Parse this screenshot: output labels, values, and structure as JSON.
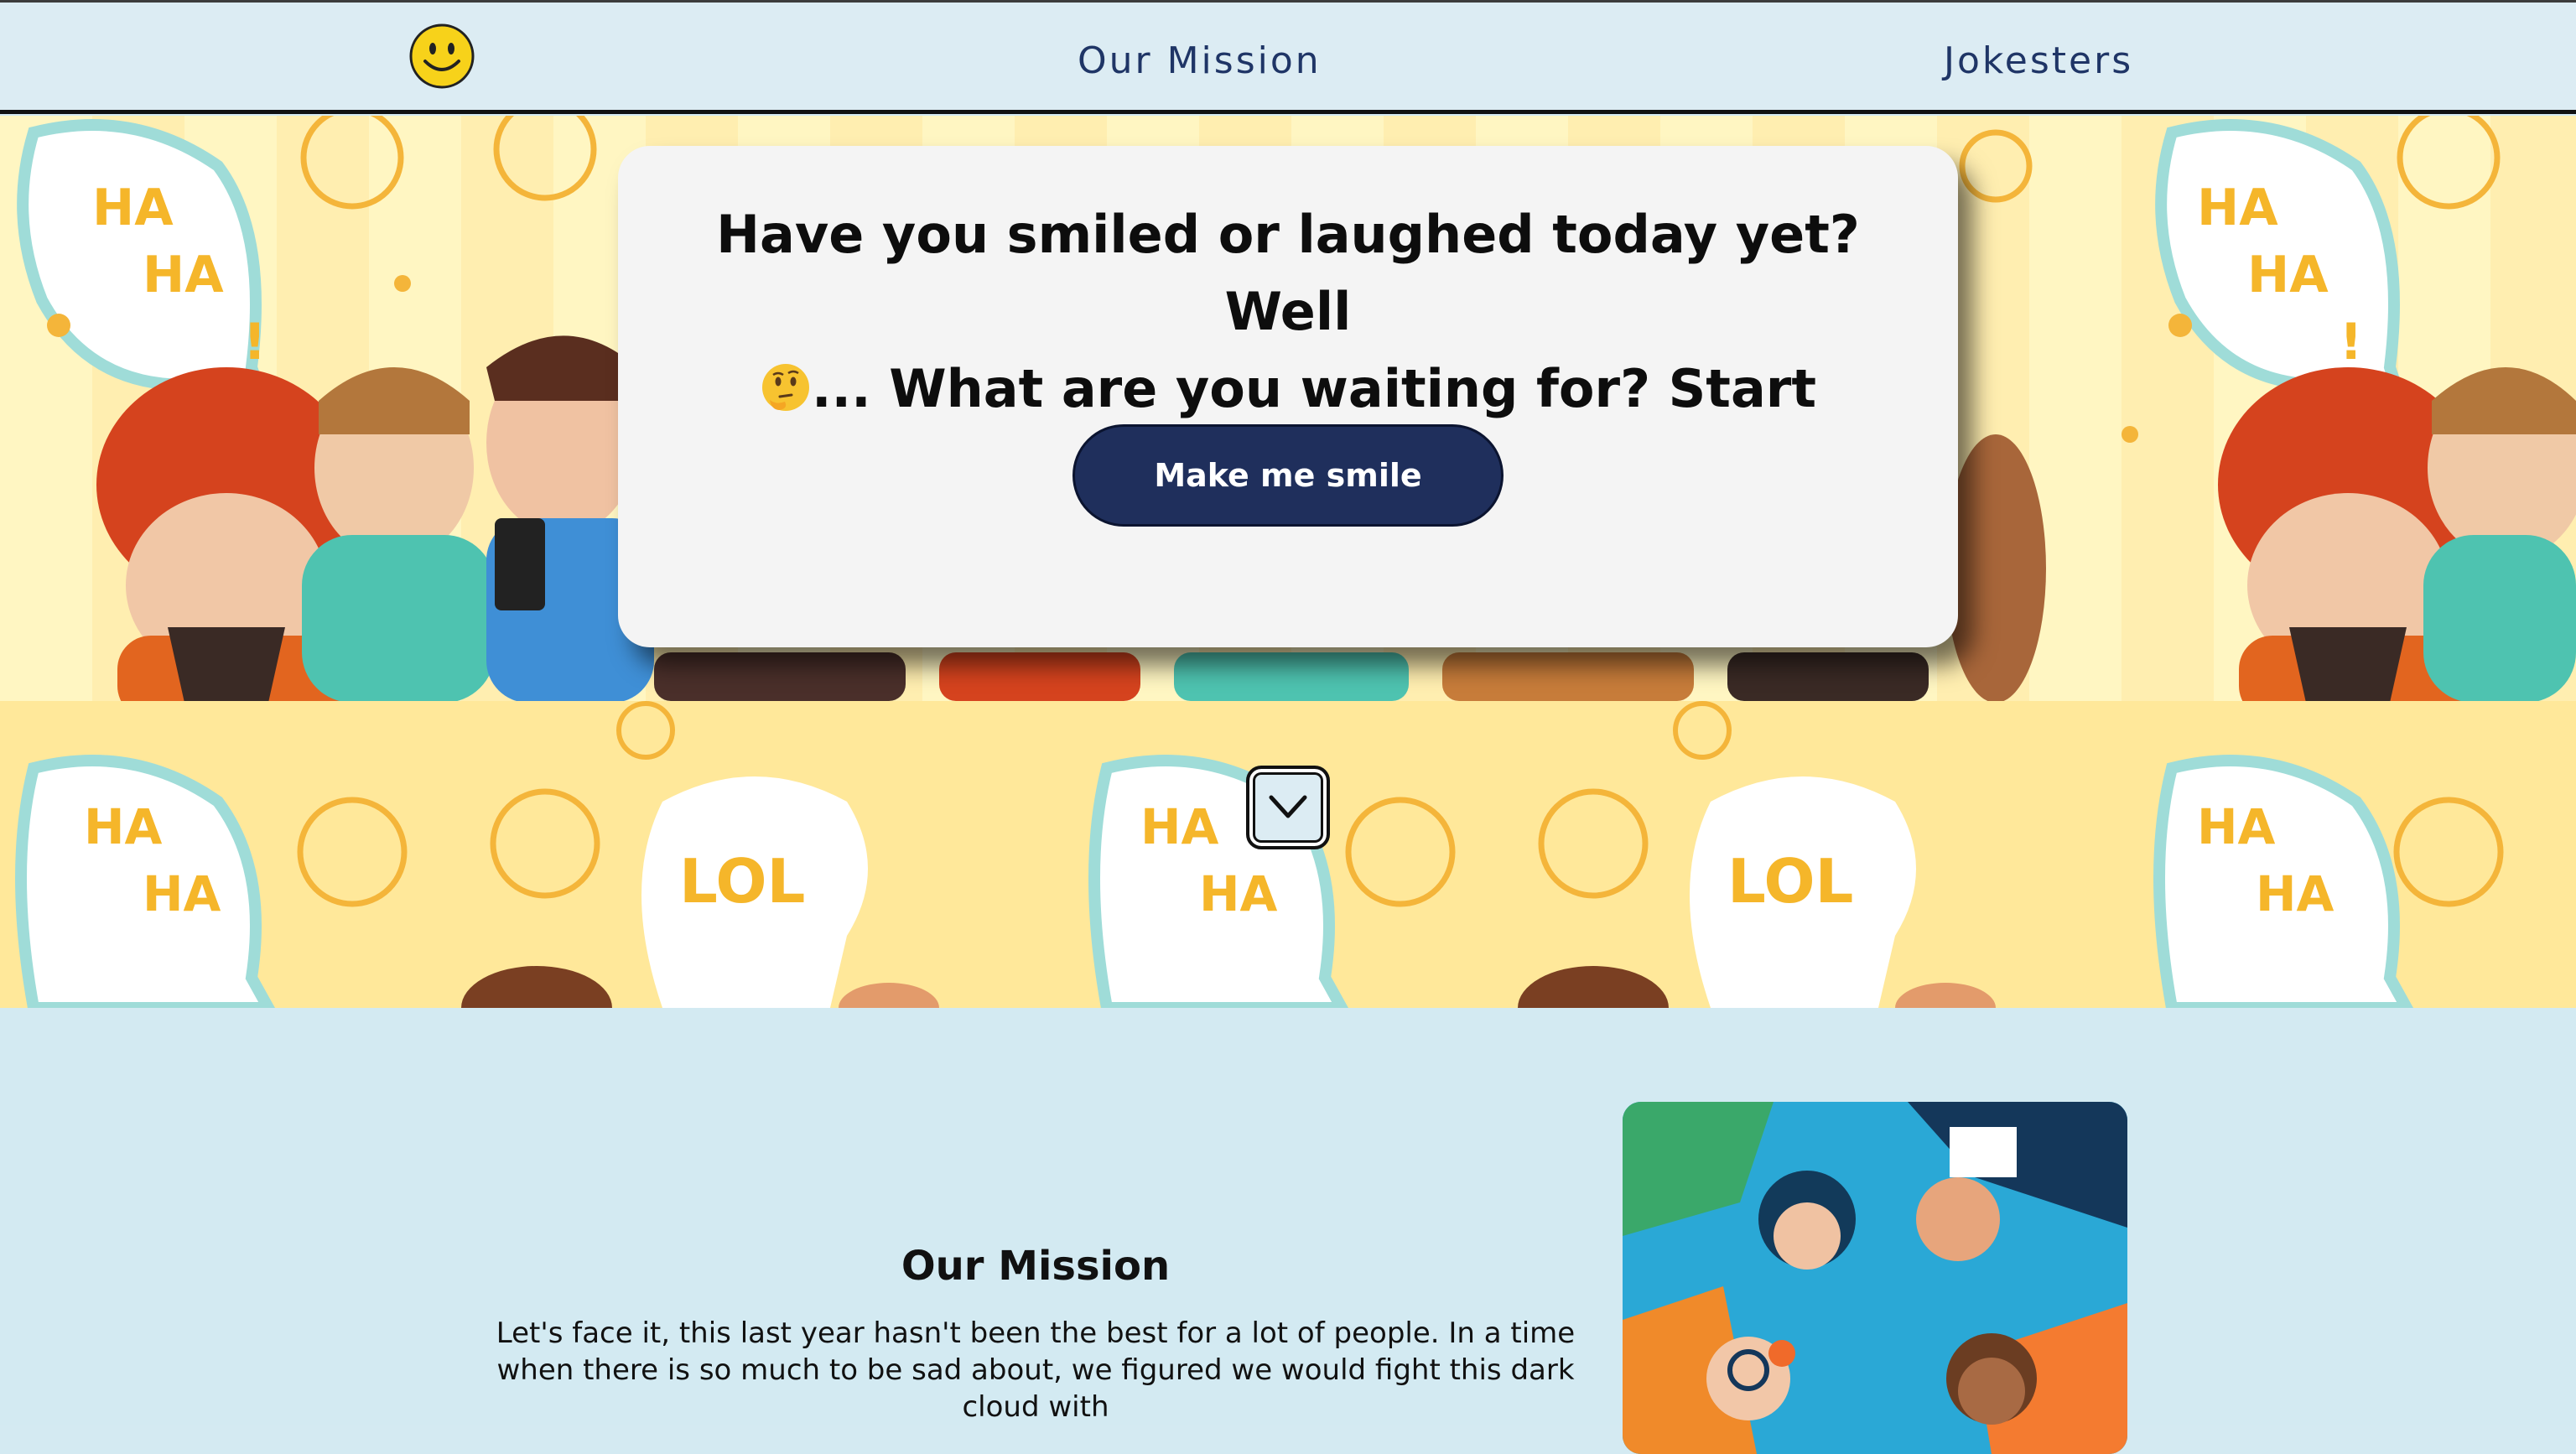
{
  "nav": {
    "logo_icon": "smiley-face-icon",
    "links": [
      {
        "label": "Our Mission"
      },
      {
        "label": "Jokesters"
      }
    ]
  },
  "hero": {
    "headline_part1": "Have you smiled or laughed today yet? Well",
    "emoji_icon": "thinking-face-icon",
    "headline_part2": "... What are you waiting for? Start smiling!",
    "cta_label": "Make me smile",
    "scroll_icon": "chevron-down-icon",
    "background_stickers": [
      "HA HA !",
      "LOL"
    ]
  },
  "mission": {
    "title": "Our Mission",
    "body": "Let's face it, this last year hasn't been the best for a lot of people. In a time when there is so much to be sad about, we figured we would fight this dark cloud with"
  },
  "colors": {
    "nav_bg": "#dcecf3",
    "nav_text": "#1f3566",
    "cta_bg": "#1f2f5c",
    "card_bg": "#f4f4f4",
    "section_bg": "#d3eaf2",
    "hero_yellow": "#ffe89a"
  }
}
